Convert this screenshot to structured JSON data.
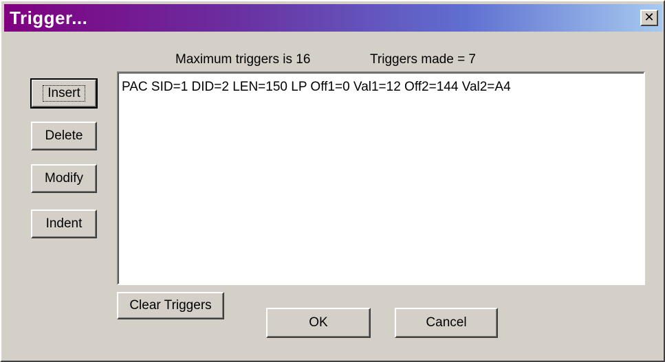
{
  "window": {
    "title": "Trigger...",
    "close_glyph": "✕"
  },
  "info": {
    "max_triggers": "Maximum triggers is 16",
    "triggers_made": "Triggers made = 7"
  },
  "side_buttons": {
    "insert": "Insert",
    "delete": "Delete",
    "modify": "Modify",
    "indent": "Indent"
  },
  "trigger_list": {
    "items": [
      "PAC SID=1 DID=2 LEN=150 LP Off1=0 Val1=12 Off2=144 Val2=A4"
    ]
  },
  "bottom_buttons": {
    "clear_triggers": "Clear Triggers",
    "ok": "OK",
    "cancel": "Cancel"
  }
}
